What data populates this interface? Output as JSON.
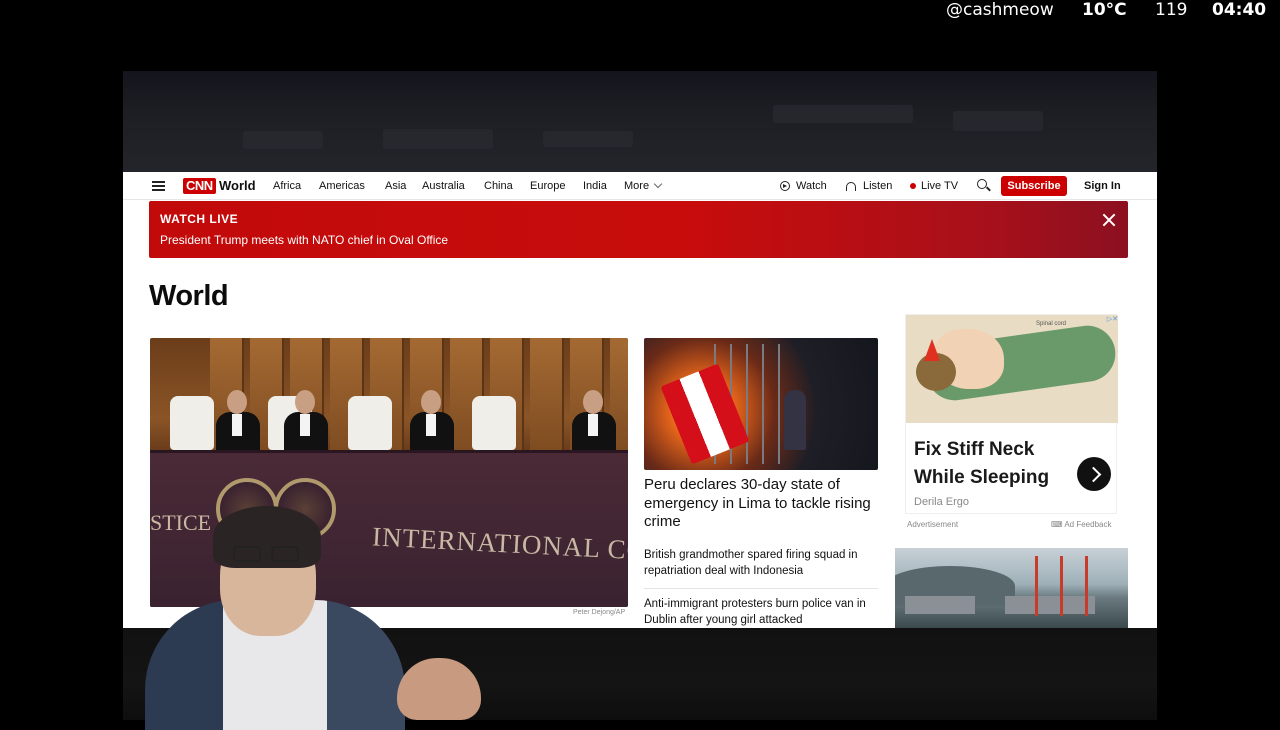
{
  "overlay": {
    "handle": "@cashmeow",
    "temperature": "10°C",
    "count": "119",
    "time": "04:40"
  },
  "nav": {
    "logo": "CNN",
    "section": "World",
    "links": [
      "Africa",
      "Americas",
      "Asia",
      "Australia",
      "China",
      "Europe",
      "India",
      "More"
    ],
    "watch": "Watch",
    "listen": "Listen",
    "live_tv": "Live TV",
    "subscribe": "Subscribe",
    "sign_in": "Sign In"
  },
  "live_banner": {
    "label": "WATCH LIVE",
    "text": "President Trump meets with NATO chief in Oval Office"
  },
  "page_title": "World",
  "hero": {
    "caption": "Peter Dejong/AP",
    "image_text_main": "INTERNATIONAL COURT",
    "image_text_left": "STICE"
  },
  "stories": {
    "lead_headline": "Peru declares 30-day state of emergency in Lima to tackle rising crime",
    "items": [
      "British grandmother spared firing squad in repatriation deal with Indonesia",
      "Anti-immigrant protesters burn police van in Dublin after young girl attacked"
    ]
  },
  "ad": {
    "title": "Fix Stiff Neck While Sleeping",
    "brand": "Derila Ergo",
    "label": "Advertisement",
    "feedback": "Ad Feedback",
    "image_label": "Spinal cord"
  },
  "colors": {
    "cnn_red": "#cc0000",
    "banner_red": "#c20a0a"
  }
}
